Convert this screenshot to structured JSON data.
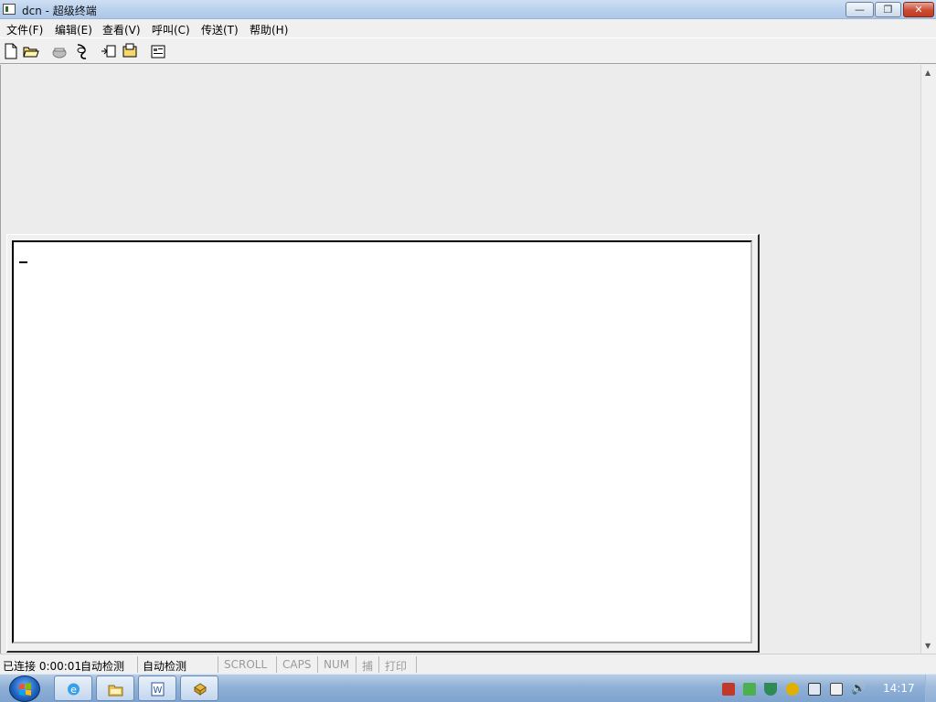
{
  "window": {
    "title": "dcn - 超级终端",
    "minimize_label": "—",
    "maximize_label": "❐",
    "close_label": "✕"
  },
  "menu": [
    {
      "label": "文件(F)"
    },
    {
      "label": "编辑(E)"
    },
    {
      "label": "查看(V)"
    },
    {
      "label": "呼叫(C)"
    },
    {
      "label": "传送(T)"
    },
    {
      "label": "帮助(H)"
    }
  ],
  "toolbar": [
    {
      "icon": "new-document-icon"
    },
    {
      "icon": "open-folder-icon"
    },
    {
      "icon": "call-phone-icon"
    },
    {
      "icon": "disconnect-icon"
    },
    {
      "icon": "send-file-icon"
    },
    {
      "icon": "receive-file-icon"
    },
    {
      "icon": "properties-icon"
    }
  ],
  "terminal": {
    "cursor": "_"
  },
  "statusbar": {
    "connection": "已连接 0:00:01",
    "detect1": "自动检测",
    "detect2": "自动检测",
    "scroll": "SCROLL",
    "caps": "CAPS",
    "num": "NUM",
    "capture": "捕",
    "print": "打印"
  },
  "taskbar": {
    "buttons": [
      {
        "icon": "internet-explorer-icon"
      },
      {
        "icon": "file-explorer-icon"
      },
      {
        "icon": "word-icon"
      },
      {
        "icon": "hyperterminal-icon"
      }
    ],
    "clock": "14:17"
  }
}
